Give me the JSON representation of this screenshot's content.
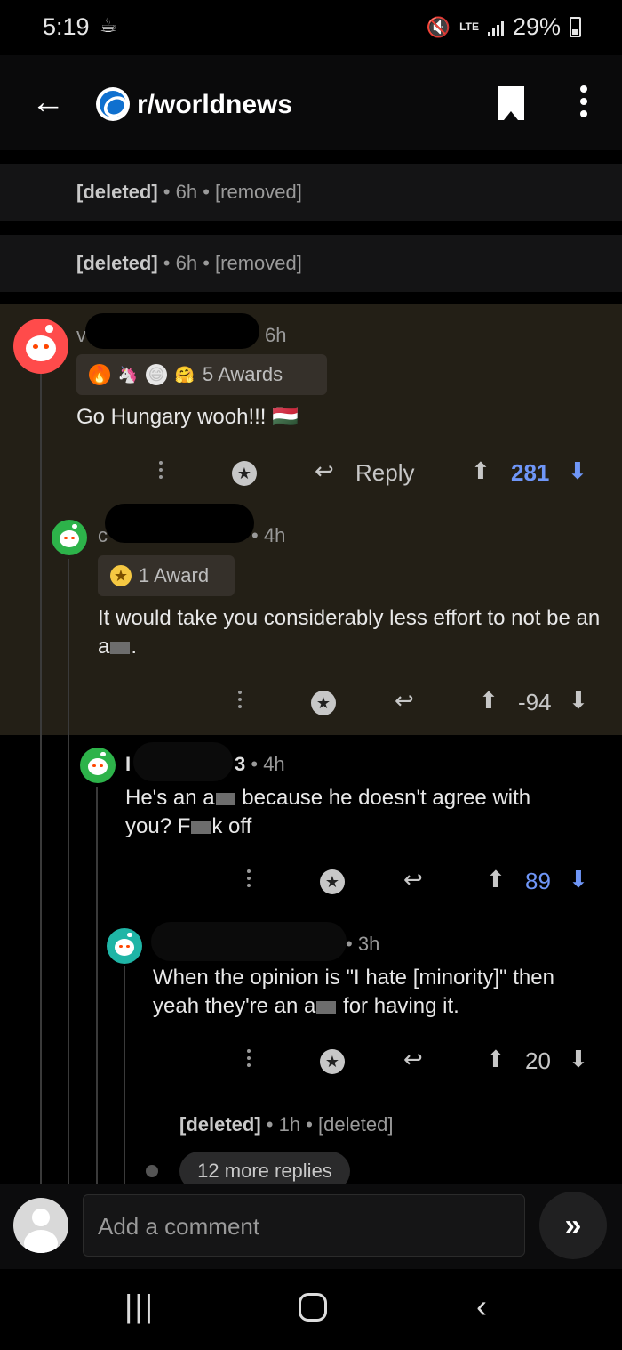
{
  "status_bar": {
    "time": "5:19",
    "network": "LTE",
    "battery": "29%"
  },
  "app_bar": {
    "subreddit": "r/worldnews"
  },
  "deleted_rows": [
    {
      "author": "[deleted]",
      "age": "6h",
      "content": "[removed]"
    },
    {
      "author": "[deleted]",
      "age": "6h",
      "content": "[removed]"
    }
  ],
  "comments": [
    {
      "author_visible": "v",
      "age": "6h",
      "awards_label": "5 Awards",
      "body": "Go Hungary wooh!!! 🇭🇺",
      "reply_label": "Reply",
      "score": "281"
    },
    {
      "author_visible": "c",
      "age": "4h",
      "awards_label": "1 Award",
      "body_part1": "It would take you considerably less effort to not be an a",
      "body_part2": ".",
      "score": "-94"
    },
    {
      "author_visible": "I",
      "author_suffix": "3",
      "age": "4h",
      "body_line1_a": "He's an a",
      "body_line1_b": " because he doesn't agree with",
      "body_line2_a": "you? F",
      "body_line2_b": "k off",
      "score": "89"
    },
    {
      "age": "3h",
      "body_line1": "When the opinion is \"I hate [minority]\" then",
      "body_line2_a": "yeah they're an a",
      "body_line2_b": " for having it.",
      "score": "20"
    }
  ],
  "deleted_reply": {
    "author": "[deleted]",
    "age": "1h",
    "content": "[deleted]"
  },
  "more_replies": "12 more replies",
  "composer": {
    "placeholder": "Add a comment"
  },
  "colors": {
    "highlight_bg": "#231f16",
    "upvote_blue": "#6f96f7",
    "background": "#000000"
  }
}
